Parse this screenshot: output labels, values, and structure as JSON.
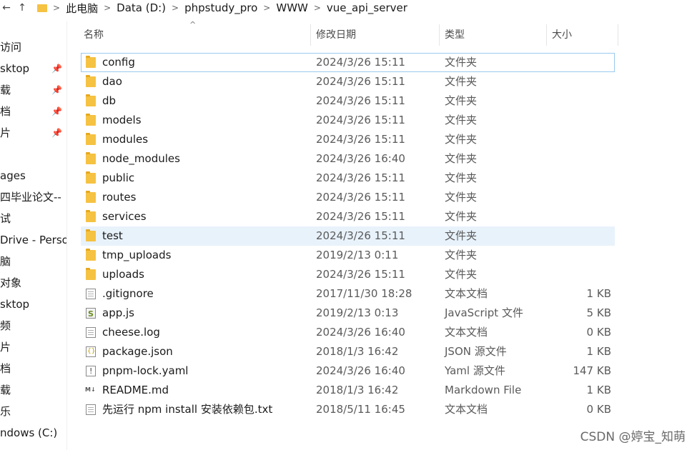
{
  "breadcrumb": [
    "此电脑",
    "Data (D:)",
    "phpstudy_pro",
    "WWW",
    "vue_api_server"
  ],
  "nav_items": [
    {
      "label": "访问",
      "pinned": false
    },
    {
      "label": "sktop",
      "pinned": true
    },
    {
      "label": "载",
      "pinned": true
    },
    {
      "label": "档",
      "pinned": true
    },
    {
      "label": "片",
      "pinned": true
    },
    {
      "label": "",
      "pinned": false
    },
    {
      "label": "ages",
      "pinned": false
    },
    {
      "label": "四毕业论文--",
      "pinned": false
    },
    {
      "label": "试",
      "pinned": false
    },
    {
      "label": "Drive - Perso",
      "pinned": false
    },
    {
      "label": "脑",
      "pinned": false
    },
    {
      "label": "对象",
      "pinned": false
    },
    {
      "label": "sktop",
      "pinned": false
    },
    {
      "label": "频",
      "pinned": false
    },
    {
      "label": "片",
      "pinned": false
    },
    {
      "label": "档",
      "pinned": false
    },
    {
      "label": "载",
      "pinned": false
    },
    {
      "label": "乐",
      "pinned": false
    },
    {
      "label": "ndows (C:)",
      "pinned": false
    }
  ],
  "columns": {
    "name": "名称",
    "date": "修改日期",
    "type": "类型",
    "size": "大小"
  },
  "files": [
    {
      "name": "config",
      "date": "2024/3/26 15:11",
      "type": "文件夹",
      "size": "",
      "icon": "folder",
      "state": "focus"
    },
    {
      "name": "dao",
      "date": "2024/3/26 15:11",
      "type": "文件夹",
      "size": "",
      "icon": "folder",
      "state": ""
    },
    {
      "name": "db",
      "date": "2024/3/26 15:11",
      "type": "文件夹",
      "size": "",
      "icon": "folder",
      "state": ""
    },
    {
      "name": "models",
      "date": "2024/3/26 15:11",
      "type": "文件夹",
      "size": "",
      "icon": "folder",
      "state": ""
    },
    {
      "name": "modules",
      "date": "2024/3/26 15:11",
      "type": "文件夹",
      "size": "",
      "icon": "folder",
      "state": ""
    },
    {
      "name": "node_modules",
      "date": "2024/3/26 16:40",
      "type": "文件夹",
      "size": "",
      "icon": "folder",
      "state": ""
    },
    {
      "name": "public",
      "date": "2024/3/26 15:11",
      "type": "文件夹",
      "size": "",
      "icon": "folder",
      "state": ""
    },
    {
      "name": "routes",
      "date": "2024/3/26 15:11",
      "type": "文件夹",
      "size": "",
      "icon": "folder",
      "state": ""
    },
    {
      "name": "services",
      "date": "2024/3/26 15:11",
      "type": "文件夹",
      "size": "",
      "icon": "folder",
      "state": ""
    },
    {
      "name": "test",
      "date": "2024/3/26 15:11",
      "type": "文件夹",
      "size": "",
      "icon": "folder",
      "state": "sel"
    },
    {
      "name": "tmp_uploads",
      "date": "2019/2/13 0:11",
      "type": "文件夹",
      "size": "",
      "icon": "folder",
      "state": ""
    },
    {
      "name": "uploads",
      "date": "2024/3/26 15:11",
      "type": "文件夹",
      "size": "",
      "icon": "folder",
      "state": ""
    },
    {
      "name": ".gitignore",
      "date": "2017/11/30 18:28",
      "type": "文本文档",
      "size": "1 KB",
      "icon": "doc",
      "state": ""
    },
    {
      "name": "app.js",
      "date": "2019/2/13 0:13",
      "type": "JavaScript 文件",
      "size": "5 KB",
      "icon": "js",
      "state": ""
    },
    {
      "name": "cheese.log",
      "date": "2024/3/26 16:40",
      "type": "文本文档",
      "size": "0 KB",
      "icon": "doc",
      "state": ""
    },
    {
      "name": "package.json",
      "date": "2018/1/3 16:42",
      "type": "JSON 源文件",
      "size": "1 KB",
      "icon": "json",
      "state": ""
    },
    {
      "name": "pnpm-lock.yaml",
      "date": "2024/3/26 16:40",
      "type": "Yaml 源文件",
      "size": "147 KB",
      "icon": "yaml",
      "state": ""
    },
    {
      "name": "README.md",
      "date": "2018/1/3 16:42",
      "type": "Markdown File",
      "size": "1 KB",
      "icon": "md",
      "state": ""
    },
    {
      "name": "先运行 npm install 安装依赖包.txt",
      "date": "2018/5/11 16:45",
      "type": "文本文档",
      "size": "0 KB",
      "icon": "doc",
      "state": ""
    }
  ],
  "watermark": "CSDN @婷宝_知萌"
}
